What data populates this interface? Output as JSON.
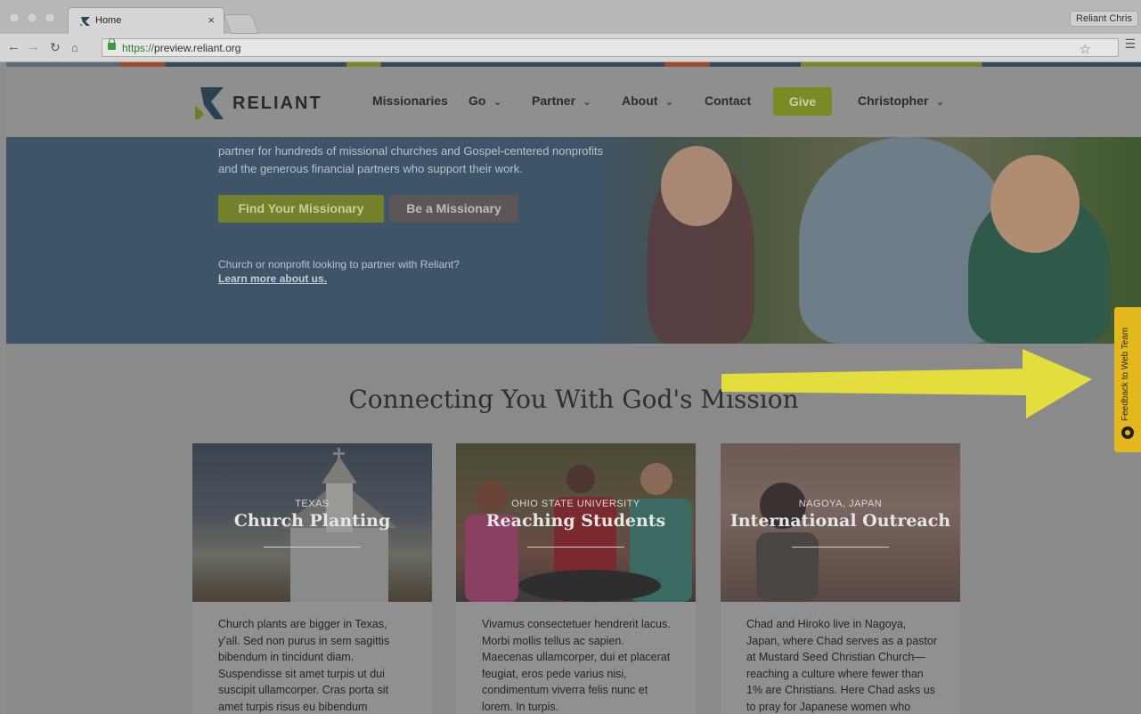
{
  "browser": {
    "tab_title": "Home",
    "tab_close": "×",
    "profile": "Reliant Chris",
    "url_scheme": "https://",
    "url_host": "preview.reliant.org",
    "back_icon": "arrow-left-icon",
    "forward_icon": "arrow-right-icon",
    "reload_icon": "reload-icon",
    "home_icon": "home-icon",
    "star_icon": "star-icon",
    "menu_icon": "hamburger-icon"
  },
  "site": {
    "brand": "RELIANT",
    "nav": [
      {
        "label": "Missionaries",
        "has_menu": false
      },
      {
        "label": "Go",
        "has_menu": true
      },
      {
        "label": "Partner",
        "has_menu": true
      },
      {
        "label": "About",
        "has_menu": true
      },
      {
        "label": "Contact",
        "has_menu": false
      }
    ],
    "give_label": "Give",
    "user_label": "Christopher"
  },
  "hero": {
    "text": "partner for hundreds of missional churches and Gospel-centered nonprofits and the generous financial partners who support their work.",
    "btn_find": "Find Your Missionary",
    "btn_be": "Be a Missionary",
    "partner_question": "Church or nonprofit looking to partner with Reliant?",
    "learn_more": "Learn more about us",
    "learn_more_suffix": "."
  },
  "section": {
    "title": "Connecting You With God's Mission"
  },
  "cards": [
    {
      "eyebrow": "TEXAS",
      "title": "Church Planting",
      "body": "Church plants are bigger in Texas, y'all. Sed non purus in sem sagittis bibendum in tincidunt diam. Suspendisse sit amet turpis ut dui suscipit ullamcorper. Cras porta sit amet turpis risus eu bibendum"
    },
    {
      "eyebrow": "OHIO STATE UNIVERSITY",
      "title": "Reaching Students",
      "body": "Vivamus consectetuer hendrerit lacus. Morbi mollis tellus ac sapien. Maecenas ullamcorper, dui et placerat feugiat, eros pede varius nisi, condimentum viverra felis nunc et lorem. In turpis."
    },
    {
      "eyebrow": "NAGOYA, JAPAN",
      "title": "International Outreach",
      "body": "Chad and Hiroko live in Nagoya, Japan, where Chad serves as a pastor at Mustard Seed Christian Church—reaching a culture where fewer than 1% are Christians. Here Chad asks us to pray for Japanese women who"
    }
  ],
  "feedback": {
    "label": "Feedback to Web Team"
  },
  "colors": {
    "overlay_dim": "#8a8a8a",
    "hero_blue": "#3e5468",
    "give_green": "#7a8a25",
    "feedback_yellow": "#e3b81c",
    "arrow_yellow": "#e8e23a"
  }
}
